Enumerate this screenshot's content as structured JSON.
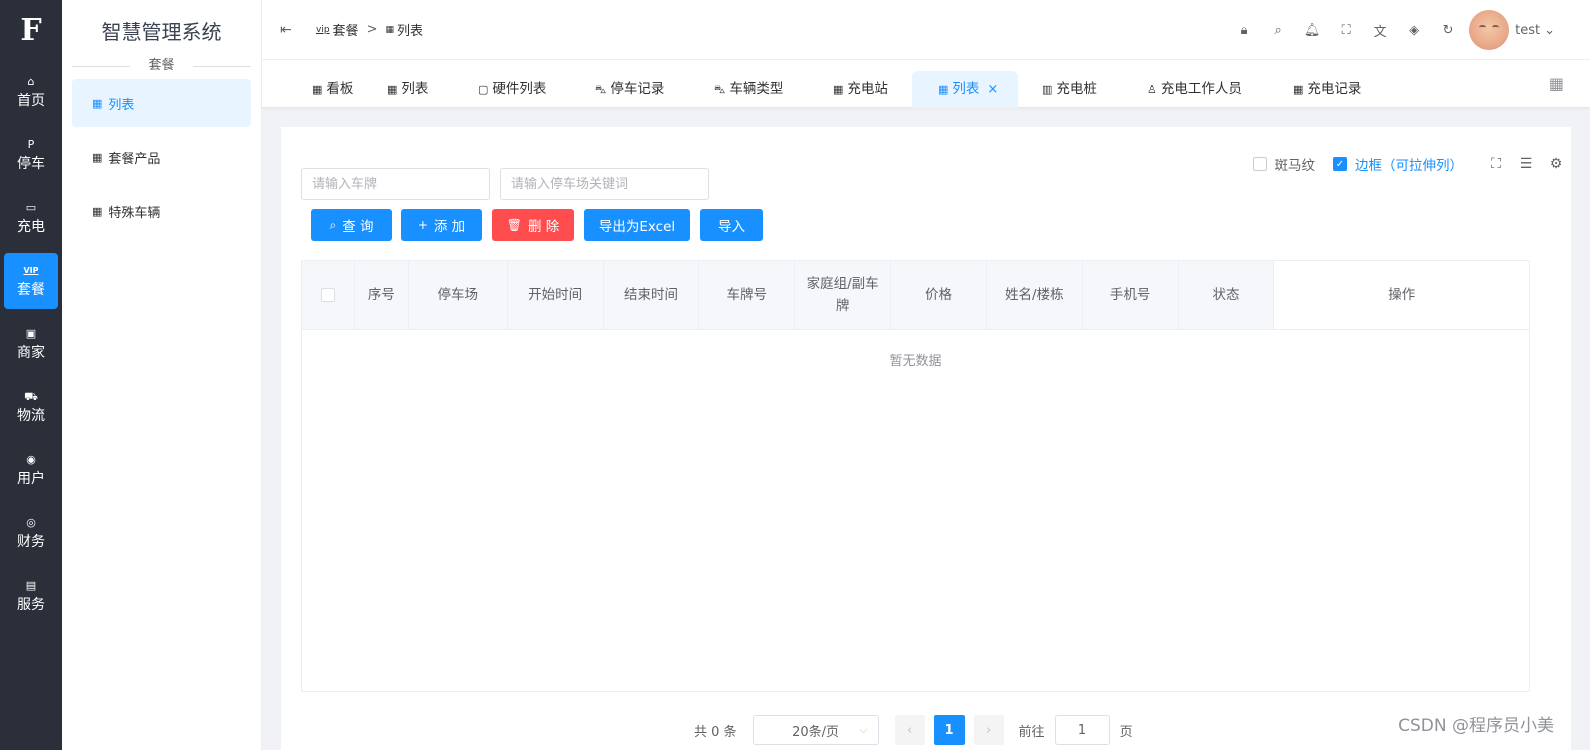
{
  "rail": {
    "logo": "F",
    "items": [
      {
        "label": "首页",
        "icon": "home-icon",
        "glyph": "⌂"
      },
      {
        "label": "停车",
        "icon": "parking-icon",
        "glyph": "P"
      },
      {
        "label": "充电",
        "icon": "battery-icon",
        "glyph": "▭"
      },
      {
        "label": "套餐",
        "icon": "vip-icon",
        "glyph": "VIP"
      },
      {
        "label": "商家",
        "icon": "shop-icon",
        "glyph": "▣"
      },
      {
        "label": "物流",
        "icon": "truck-icon",
        "glyph": "⛟"
      },
      {
        "label": "用户",
        "icon": "user-icon",
        "glyph": "◉"
      },
      {
        "label": "财务",
        "icon": "finance-icon",
        "glyph": "◎"
      },
      {
        "label": "服务",
        "icon": "service-icon",
        "glyph": "▤"
      }
    ],
    "active_index": 3
  },
  "sidebar": {
    "title": "智慧管理系统",
    "group": "套餐",
    "items": [
      {
        "label": "列表",
        "icon": "grid-icon"
      },
      {
        "label": "套餐产品",
        "icon": "grid-icon"
      },
      {
        "label": "特殊车辆",
        "icon": "grid-icon"
      }
    ]
  },
  "header": {
    "breadcrumb": [
      {
        "label": "套餐",
        "glyph": "vip"
      },
      {
        "label": "列表",
        "glyph": "▦"
      }
    ],
    "breadcrumb_sep": ">",
    "username": "test",
    "username_caret": "⌄"
  },
  "tabs": [
    {
      "label": "看板",
      "glyph": "▦"
    },
    {
      "label": "列表",
      "glyph": "▦"
    },
    {
      "label": "硬件列表",
      "glyph": "▢"
    },
    {
      "label": "停车记录",
      "glyph": "⛍"
    },
    {
      "label": "车辆类型",
      "glyph": "⛍"
    },
    {
      "label": "充电站",
      "glyph": "▦"
    },
    {
      "label": "列表",
      "glyph": "▦",
      "active": true,
      "close": "×"
    },
    {
      "label": "充电桩",
      "glyph": "▥"
    },
    {
      "label": "充电工作人员",
      "glyph": "♙"
    },
    {
      "label": "充电记录",
      "glyph": "▦"
    }
  ],
  "filters": {
    "plate_placeholder": "请输入车牌",
    "lot_placeholder": "请输入停车场关键词"
  },
  "buttons": {
    "query": "查 询",
    "add": "添 加",
    "delete": "删 除",
    "export": "导出为Excel",
    "import": "导入"
  },
  "options": {
    "stripe": "斑马纹",
    "border": "边框（可拉伸列）",
    "border_checked": true,
    "stripe_checked": false
  },
  "table": {
    "columns": [
      "序号",
      "停车场",
      "开始时间",
      "结束时间",
      "车牌号",
      "家庭组/副车牌",
      "价格",
      "姓名/楼栋",
      "手机号",
      "状态",
      "操作"
    ],
    "empty_text": "暂无数据"
  },
  "pagination": {
    "total": "共 0 条",
    "page_size": "20条/页",
    "prev": "‹",
    "next": "›",
    "current_page": "1",
    "goto_label": "前往",
    "goto_value": "1",
    "page_suffix": "页"
  },
  "watermark": "CSDN @程序员小美",
  "colors": {
    "accent": "#1890ff",
    "danger": "#ff4d4f",
    "rail_bg": "#2a2f3a"
  }
}
